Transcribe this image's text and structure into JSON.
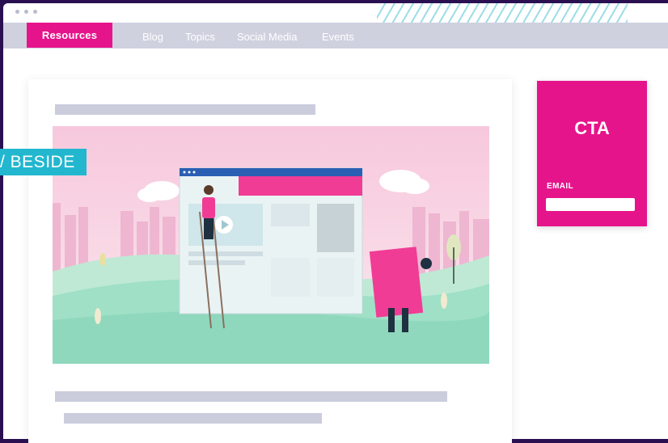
{
  "nav": {
    "active": "Resources",
    "links": [
      "Blog",
      "Topics",
      "Social Media",
      "Events"
    ]
  },
  "cta": {
    "title": "CTA",
    "email_label": "EMAIL",
    "email_value": ""
  },
  "badge": "/ BESIDE",
  "colors": {
    "accent": "#e6148b",
    "nav_bg": "#cfd1df",
    "badge": "#22b7cf",
    "placeholder_bar": "#cbcddd",
    "page_border": "#2a1050"
  }
}
